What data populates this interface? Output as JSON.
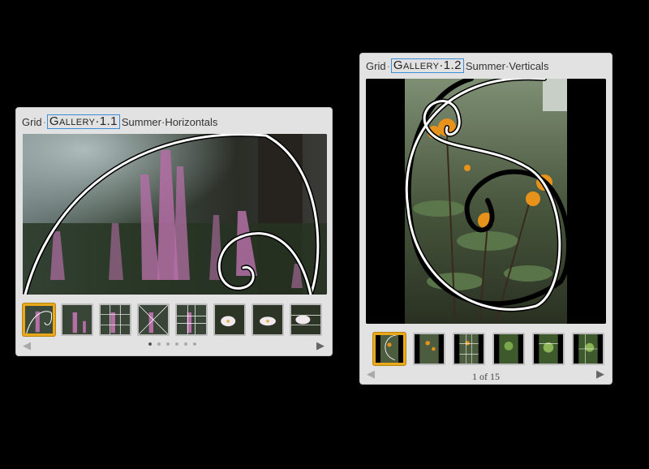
{
  "left_panel": {
    "title_prefix": "Grid",
    "gallery_label": "Gallery",
    "gallery_number": "1.1",
    "subtitle": "Summer",
    "subtitle2": "Horizontals",
    "thumbnails": [
      "astilbe-spiral",
      "astilbe-1",
      "astilbe-grid",
      "astilbe-diag",
      "astilbe-grid2",
      "cosmos-1",
      "cosmos-2",
      "cosmos-3"
    ],
    "selected_index": 0,
    "dots": 6,
    "active_dot": 0
  },
  "right_panel": {
    "title_prefix": "Grid",
    "gallery_label": "Gallery",
    "gallery_number": "1.2",
    "subtitle": "Summer",
    "subtitle2": "Verticals",
    "thumbnails": [
      "rudbeckia-spiral",
      "rudbeckia-1",
      "rudbeckia-2",
      "green-1",
      "green-2",
      "green-3"
    ],
    "selected_index": 0,
    "counter": "1 of 15"
  },
  "icons": {
    "prev": "arrow-left-icon",
    "next": "arrow-right-icon"
  },
  "colors": {
    "selection": "#e9a91a",
    "gallery_box": "#3b8fd9",
    "panel_bg": "#e2e2e2"
  }
}
